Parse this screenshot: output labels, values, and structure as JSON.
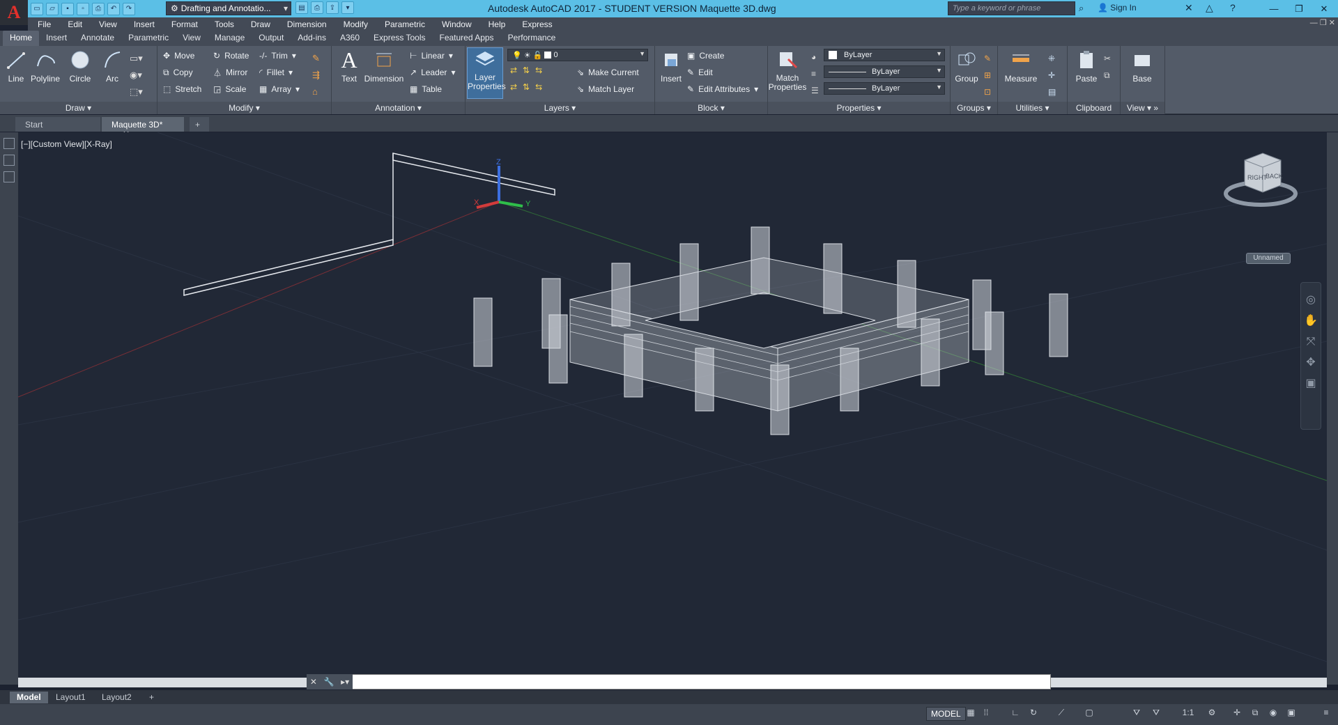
{
  "titlebar": {
    "app_logo": "A",
    "workspace": "Drafting and Annotatio...",
    "title": "Autodesk AutoCAD 2017 - STUDENT VERSION    Maquette 3D.dwg",
    "search_placeholder": "Type a keyword or phrase",
    "sign_in": "Sign In"
  },
  "menubar": [
    "File",
    "Edit",
    "View",
    "Insert",
    "Format",
    "Tools",
    "Draw",
    "Dimension",
    "Modify",
    "Parametric",
    "Window",
    "Help",
    "Express"
  ],
  "ribbon_tabs": [
    "Home",
    "Insert",
    "Annotate",
    "Parametric",
    "View",
    "Manage",
    "Output",
    "Add-ins",
    "A360",
    "Express Tools",
    "Featured Apps",
    "Performance"
  ],
  "ribbon": {
    "draw": {
      "title": "Draw",
      "line": "Line",
      "polyline": "Polyline",
      "circle": "Circle",
      "arc": "Arc"
    },
    "modify": {
      "title": "Modify",
      "move": "Move",
      "rotate": "Rotate",
      "trim": "Trim",
      "copy": "Copy",
      "mirror": "Mirror",
      "fillet": "Fillet",
      "stretch": "Stretch",
      "scale": "Scale",
      "array": "Array"
    },
    "annotation": {
      "title": "Annotation",
      "text": "Text",
      "dimension": "Dimension",
      "linear": "Linear",
      "leader": "Leader",
      "table": "Table"
    },
    "layers": {
      "title": "Layers",
      "layer_properties": "Layer Properties",
      "layer_value": "0",
      "make_current": "Make Current",
      "match_layer": "Match Layer"
    },
    "block": {
      "title": "Block",
      "insert": "Insert",
      "create": "Create",
      "edit": "Edit",
      "edit_attributes": "Edit Attributes"
    },
    "properties": {
      "title": "Properties",
      "match_properties": "Match Properties",
      "color": "ByLayer",
      "linetype": "ByLayer",
      "lineweight": "ByLayer"
    },
    "groups": {
      "title": "Groups",
      "group": "Group"
    },
    "utilities": {
      "title": "Utilities",
      "measure": "Measure"
    },
    "clipboard": {
      "title": "Clipboard",
      "paste": "Paste"
    },
    "view": {
      "title": "View",
      "base": "Base"
    }
  },
  "doc_tabs": [
    "Start",
    "Maquette 3D*"
  ],
  "viewport": {
    "label": "[−][Custom View][X-Ray]",
    "viewcube_right": "RIGHT",
    "viewcube_back": "BACK",
    "ucs_name": "Unnamed"
  },
  "layout_tabs": [
    "Model",
    "Layout1",
    "Layout2"
  ],
  "status": {
    "model": "MODEL",
    "scale": "1:1"
  }
}
